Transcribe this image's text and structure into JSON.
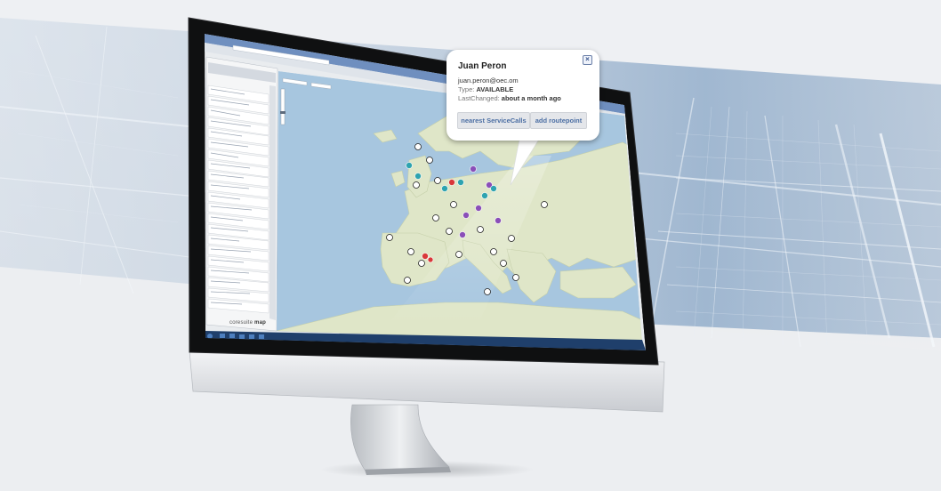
{
  "popup": {
    "name": "Juan Peron",
    "email": "juan.peron@oec.om",
    "type_label": "Type:",
    "type_value": "AVAILABLE",
    "changed_label": "LastChanged:",
    "changed_value": "about a month ago",
    "buttons": [
      "nearest ServiceCalls",
      "add routepoint"
    ],
    "close_icon": "close-icon"
  },
  "brand": {
    "prefix": "coresuite",
    "suffix": "map"
  },
  "colors": {
    "sea": "#a7c6df",
    "land": "#dfe6c8",
    "screen_bezel": "#111111",
    "popup_button_text": "#4b6ea3",
    "marker_purple": "#8a4fb8",
    "marker_teal": "#2ea3b0",
    "marker_red": "#d9383a",
    "marker_white": "#ffffff"
  }
}
